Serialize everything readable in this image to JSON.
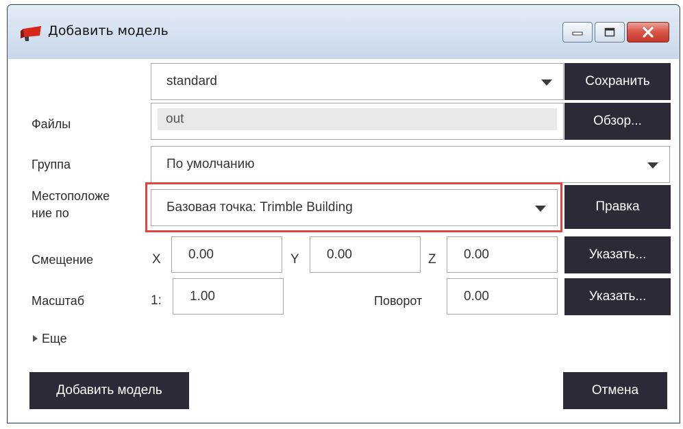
{
  "window": {
    "title": "Добавить модель",
    "controls": {
      "minimize": "minimize",
      "maximize": "maximize",
      "close": "close"
    }
  },
  "template": {
    "value": "standard",
    "save_label": "Сохранить"
  },
  "files": {
    "label": "Файлы",
    "value": "out",
    "browse_label": "Обзор..."
  },
  "group": {
    "label": "Группа",
    "value": "По умолчанию"
  },
  "location": {
    "label_line1": "Местоположе",
    "label_line2": "ние по",
    "value": "Базовая точка: Trimble Building",
    "edit_label": "Правка",
    "highlight_color": "#e0463e"
  },
  "offset": {
    "label": "Смещение",
    "x_label": "X",
    "x": "0.00",
    "y_label": "Y",
    "y": "0.00",
    "z_label": "Z",
    "z": "0.00",
    "pick_label": "Указать..."
  },
  "scale": {
    "label": "Масштаб",
    "prefix": "1:",
    "value": "1.00",
    "rotation_label": "Поворот",
    "rotation": "0.00",
    "pick_label": "Указать..."
  },
  "more_label": "Еще",
  "footer": {
    "add_label": "Добавить модель",
    "cancel_label": "Отмена"
  },
  "colors": {
    "button_bg": "#2b2a36",
    "title_gradient_top": "#e4ecf6",
    "close_red": "#c23a2c"
  }
}
